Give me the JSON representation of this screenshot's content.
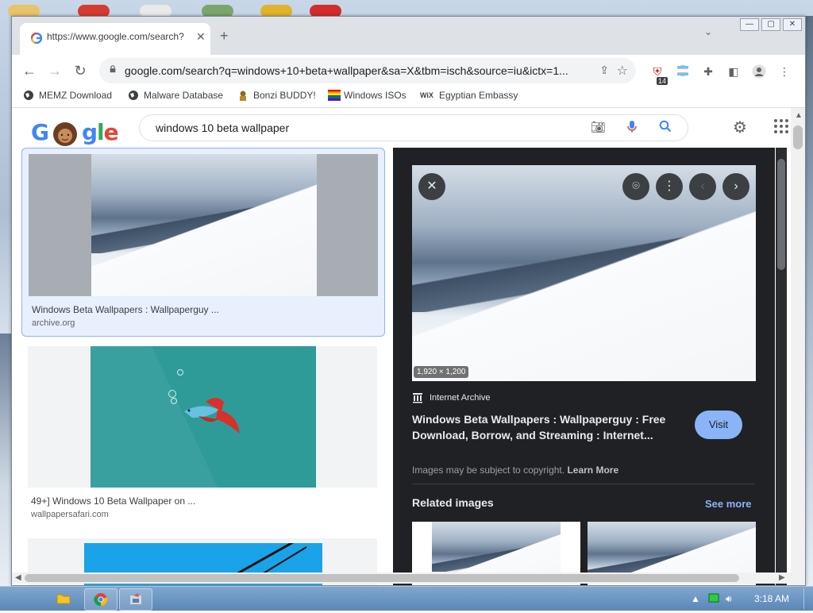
{
  "browser": {
    "tab_title": "https://www.google.com/search?",
    "tab_close": "✕",
    "new_tab": "+",
    "tab_list": "⌄",
    "url": "google.com/search?q=windows+10+beta+wallpaper&sa=X&tbm=isch&source=iu&ictx=1...",
    "extension_badge": "14",
    "window_buttons": [
      "—",
      "▢",
      "✕"
    ]
  },
  "bookmarks": [
    {
      "label": "MEMZ Download",
      "icon": "globe-icon"
    },
    {
      "label": "Malware Database",
      "icon": "globe-icon"
    },
    {
      "label": "Bonzi BUDDY!",
      "icon": "bonzi-icon"
    },
    {
      "label": "Windows ISOs",
      "icon": "windows-flag-icon"
    },
    {
      "label": "Egyptian Embassy",
      "icon": "wix-icon"
    }
  ],
  "search": {
    "logo": "Google",
    "query": "windows 10 beta wallpaper"
  },
  "results": [
    {
      "title": "Windows Beta Wallpapers : Wallpaperguy ...",
      "source": "archive.org"
    },
    {
      "title": "49+] Windows 10 Beta Wallpaper on ...",
      "source": "wallpapersafari.com"
    }
  ],
  "preview": {
    "dimensions": "1,920 × 1,200",
    "source": "Internet Archive",
    "title": "Windows Beta Wallpapers : Wallpaperguy : Free Download, Borrow, and Streaming : Internet...",
    "visit": "Visit",
    "copyright": "Images may be subject to copyright.",
    "learn_more": "Learn More",
    "related": "Related images",
    "see_more": "See more"
  },
  "taskbar": {
    "clock": "3:18 AM"
  },
  "colors": {
    "accent": "#8ab4f8",
    "preview_bg": "#202124"
  }
}
